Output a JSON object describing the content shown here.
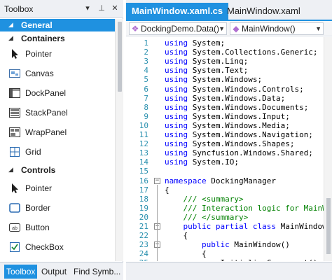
{
  "toolbox": {
    "title": "Toolbox",
    "header_buttons": {
      "dropdown": "▾",
      "pin": "⊥",
      "close": "✕"
    },
    "categories": [
      {
        "label": "General",
        "expanded": true,
        "selected": true
      },
      {
        "label": "Containers",
        "expanded": true
      },
      {
        "label": "Controls",
        "expanded": true
      }
    ],
    "container_items": [
      {
        "label": "Pointer",
        "icon": "pointer-arrow-icon"
      },
      {
        "label": "Canvas",
        "icon": "canvas-icon"
      },
      {
        "label": "DockPanel",
        "icon": "dockpanel-icon"
      },
      {
        "label": "StackPanel",
        "icon": "stackpanel-icon"
      },
      {
        "label": "WrapPanel",
        "icon": "wrappanel-icon"
      },
      {
        "label": "Grid",
        "icon": "grid-icon"
      }
    ],
    "control_items": [
      {
        "label": "Pointer",
        "icon": "pointer-arrow-icon"
      },
      {
        "label": "Border",
        "icon": "border-icon"
      },
      {
        "label": "Button",
        "icon": "button-icon"
      },
      {
        "label": "CheckBox",
        "icon": "checkbox-icon"
      }
    ],
    "bottom_tabs": [
      "Toolbox",
      "Output",
      "Find Symb..."
    ]
  },
  "editor": {
    "tabs": [
      {
        "label": "MainWindow.xaml.cs",
        "active": true
      },
      {
        "label": "MainWindow.xaml",
        "active": false
      }
    ],
    "nav_left": "DockingDemo.Data()",
    "nav_right": "MainWindow()",
    "lines": [
      {
        "n": "1",
        "parts": [
          [
            "kw",
            "using"
          ],
          [
            "tx",
            " System;"
          ]
        ]
      },
      {
        "n": "2",
        "parts": [
          [
            "kw",
            "using"
          ],
          [
            "tx",
            " System.Collections.Generic;"
          ]
        ]
      },
      {
        "n": "3",
        "parts": [
          [
            "kw",
            "using"
          ],
          [
            "tx",
            " System.Linq;"
          ]
        ]
      },
      {
        "n": "4",
        "parts": [
          [
            "kw",
            "using"
          ],
          [
            "tx",
            " System.Text;"
          ]
        ]
      },
      {
        "n": "5",
        "parts": [
          [
            "kw",
            "using"
          ],
          [
            "tx",
            " System.Windows;"
          ]
        ]
      },
      {
        "n": "6",
        "parts": [
          [
            "kw",
            "using"
          ],
          [
            "tx",
            " System.Windows.Controls;"
          ]
        ]
      },
      {
        "n": "7",
        "parts": [
          [
            "kw",
            "using"
          ],
          [
            "tx",
            " System.Windows.Data;"
          ]
        ]
      },
      {
        "n": "8",
        "parts": [
          [
            "kw",
            "using"
          ],
          [
            "tx",
            " System.Windows.Documents;"
          ]
        ]
      },
      {
        "n": "9",
        "parts": [
          [
            "kw",
            "using"
          ],
          [
            "tx",
            " System.Windows.Input;"
          ]
        ]
      },
      {
        "n": "10",
        "parts": [
          [
            "kw",
            "using"
          ],
          [
            "tx",
            " System.Windows.Media;"
          ]
        ]
      },
      {
        "n": "11",
        "parts": [
          [
            "kw",
            "using"
          ],
          [
            "tx",
            " System.Windows.Navigation;"
          ]
        ]
      },
      {
        "n": "12",
        "parts": [
          [
            "kw",
            "using"
          ],
          [
            "tx",
            " System.Windows.Shapes;"
          ]
        ]
      },
      {
        "n": "13",
        "parts": [
          [
            "kw",
            "using"
          ],
          [
            "tx",
            " Syncfusion.Windows.Shared;"
          ]
        ]
      },
      {
        "n": "14",
        "parts": [
          [
            "kw",
            "using"
          ],
          [
            "tx",
            " System.IO;"
          ]
        ]
      },
      {
        "n": "15",
        "parts": []
      },
      {
        "n": "16",
        "fold": "⊟",
        "parts": [
          [
            "kw",
            "namespace"
          ],
          [
            "tx",
            " DockingManager"
          ]
        ]
      },
      {
        "n": "17",
        "parts": [
          [
            "tx",
            "{"
          ]
        ]
      },
      {
        "n": "18",
        "parts": [
          [
            "cm",
            "    /// <summary>"
          ]
        ]
      },
      {
        "n": "19",
        "parts": [
          [
            "cm",
            "    /// Interaction logic for MainW"
          ]
        ]
      },
      {
        "n": "20",
        "parts": [
          [
            "cm",
            "    /// </summary>"
          ]
        ]
      },
      {
        "n": "21",
        "fold": "⊟",
        "parts": [
          [
            "kw",
            "    public partial class"
          ],
          [
            "tx",
            " MainWindow"
          ]
        ]
      },
      {
        "n": "22",
        "parts": [
          [
            "tx",
            "    {"
          ]
        ]
      },
      {
        "n": "23",
        "fold": "⊟",
        "parts": [
          [
            "kw",
            "        public"
          ],
          [
            "tx",
            " MainWindow()"
          ]
        ]
      },
      {
        "n": "24",
        "parts": [
          [
            "tx",
            "        {"
          ]
        ]
      },
      {
        "n": "25",
        "parts": [
          [
            "tx",
            "            InitializeComponent();"
          ]
        ]
      }
    ]
  },
  "colors": {
    "accent": "#1f91e0",
    "keyword": "#0000ff",
    "comment": "#008000",
    "line_number": "#2b91af"
  }
}
